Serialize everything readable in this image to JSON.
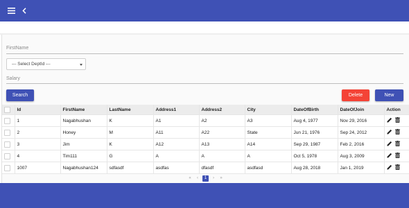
{
  "colors": {
    "primary": "#3f51b5",
    "danger": "#f44336",
    "header_bg": "#ececec"
  },
  "topbar": {
    "menu_icon": "hamburger-menu-icon",
    "back_icon": "chevron-left-icon"
  },
  "filters": {
    "first_name_label": "FirstName",
    "dept_select_value": "--- Select DeptId ---",
    "salary_label": "Salary"
  },
  "actions": {
    "search": "Search",
    "delete": "Delete",
    "new": "New"
  },
  "table": {
    "columns": [
      "Id",
      "FirstName",
      "LastName",
      "Address1",
      "Address2",
      "City",
      "DateOfBirth",
      "DateOfJoin",
      "Action"
    ],
    "rows": [
      [
        "1",
        "Nagabhushan",
        "K",
        "A1",
        "A2",
        "A3",
        "Aug 4, 1977",
        "Nov 29, 2016"
      ],
      [
        "2",
        "Honey",
        "M",
        "A11",
        "A22",
        "State",
        "Jun 21, 1976",
        "Sep 24, 2012"
      ],
      [
        "3",
        "Jim",
        "K",
        "A12",
        "A13",
        "A14",
        "Sep 29, 1987",
        "Feb 2, 2016"
      ],
      [
        "4",
        "Tim111",
        "G",
        "A",
        "A",
        "A",
        "Oct 5, 1978",
        "Aug 3, 2009"
      ],
      [
        "1007",
        "Nagabhushan124",
        "sdfasdf",
        "asdfas",
        "dfasdf",
        "asdfasd",
        "Aug 28, 2018",
        "Jan 1, 2019"
      ]
    ],
    "row_action_icons": [
      "edit-pencil-icon",
      "delete-trash-icon"
    ]
  },
  "pagination": {
    "first": "«",
    "prev": "‹",
    "current": "1",
    "next": "›",
    "last": "»"
  }
}
